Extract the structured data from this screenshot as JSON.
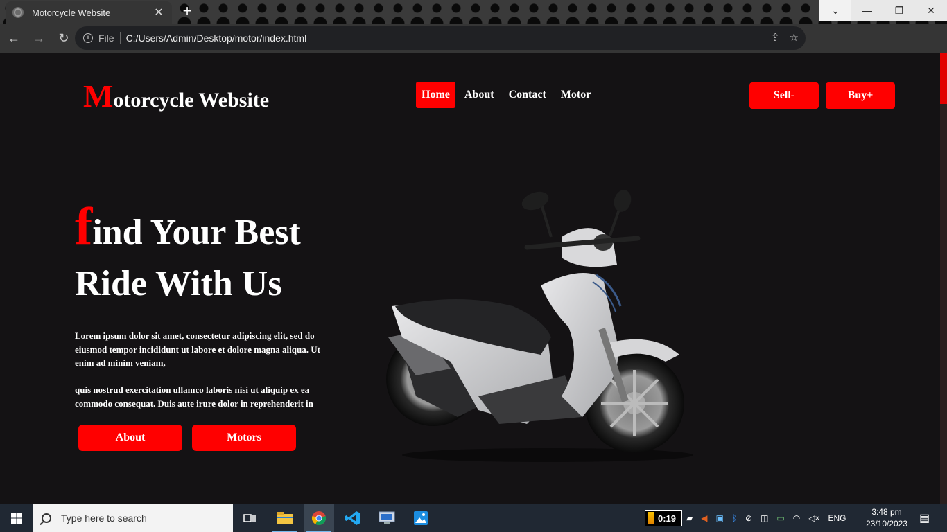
{
  "browser": {
    "tab_title": "Motorcycle Website",
    "new_tab_symbol": "+",
    "scheme_label": "File",
    "url": "C:/Users/Admin/Desktop/motor/index.html"
  },
  "site": {
    "logo_first_letter": "M",
    "logo_rest": "otorcycle Website",
    "nav": [
      {
        "label": "Home",
        "active": true
      },
      {
        "label": "About",
        "active": false
      },
      {
        "label": "Contact",
        "active": false
      },
      {
        "label": "Motor",
        "active": false
      }
    ],
    "sell_label": "Sell-",
    "buy_label": "Buy+",
    "hero": {
      "title_first_letter": "f",
      "title_line1_rest": "ind Your Best",
      "title_line2": "Ride With Us",
      "paragraph1": "Lorem ipsum dolor sit amet, consectetur adipiscing elit, sed do eiusmod tempor incididunt ut labore et dolore magna aliqua. Ut enim ad minim veniam,",
      "paragraph2": "quis nostrud exercitation ullamco laboris nisi ut aliquip ex ea commodo consequat. Duis aute irure dolor in reprehenderit in",
      "about_button": "About",
      "motors_button": "Motors"
    },
    "accent_color": "#ff0000",
    "background_color": "#141214"
  },
  "taskbar": {
    "search_placeholder": "Type here to search",
    "timer": "0:19",
    "language": "ENG",
    "time": "3:48 pm",
    "date": "23/10/2023"
  }
}
